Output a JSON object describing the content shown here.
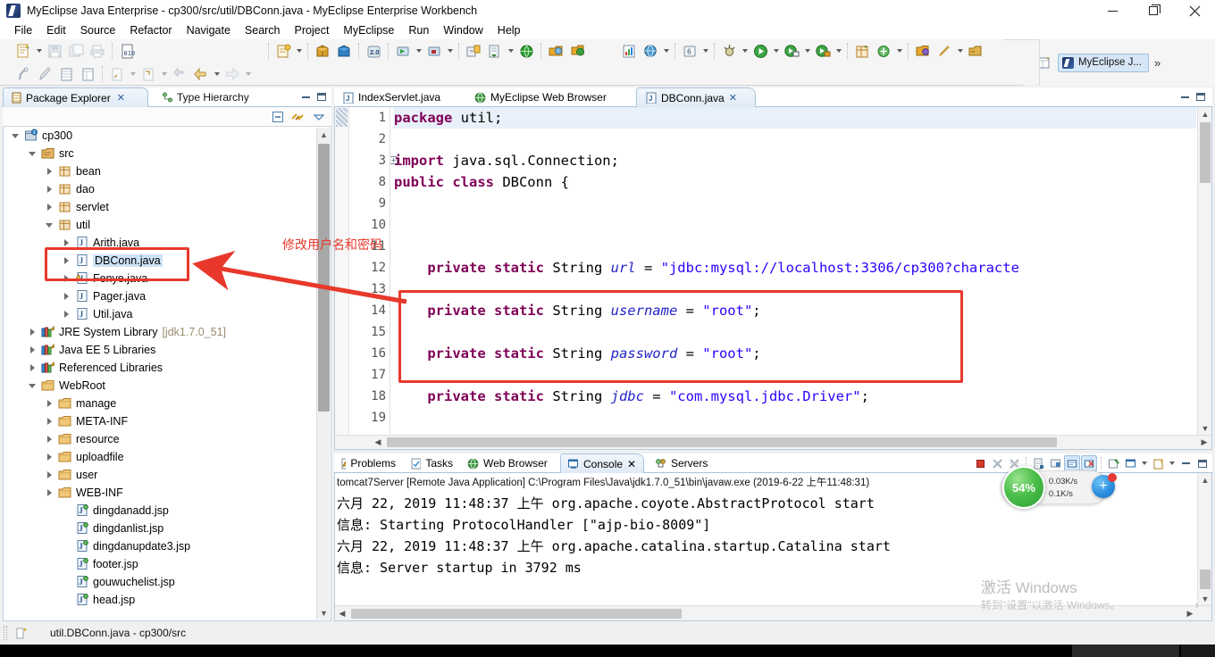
{
  "window": {
    "title": "MyEclipse Java Enterprise - cp300/src/util/DBConn.java - MyEclipse Enterprise Workbench",
    "app_icon": "myeclipse-icon",
    "controls": {
      "minimize": "minimize-icon",
      "maximize": "maximize-icon",
      "close": "close-icon"
    }
  },
  "menubar": {
    "items": [
      "File",
      "Edit",
      "Source",
      "Refactor",
      "Navigate",
      "Search",
      "Project",
      "MyEclipse",
      "Run",
      "Window",
      "Help"
    ]
  },
  "toolbar": {
    "row1_icons": [
      "new-wizard-icon",
      "save-icon",
      "save-all-icon",
      "print-icon",
      "toggle-binary-icon",
      "new-jsp-icon",
      "open-web-project-icon",
      "deploy-icon",
      "myeclipse-20-icon",
      "run-server-icon",
      "stop-server-icon",
      "sync-icon",
      "export-icon",
      "web-browser-icon",
      "open-resource-icon",
      "refresh-icon",
      "new-chart-icon",
      "globe-db-icon",
      "history-icon",
      "debug-icon",
      "run-icon",
      "run-config-icon",
      "run-secure-icon",
      "new-package-icon",
      "new-class-icon",
      "open-folder-icon",
      "quick-fix-icon",
      "open-type-icon"
    ],
    "row2_icons": [
      "annotation-icon",
      "pen-icon",
      "table-icon",
      "column-icon",
      "previous-edit-icon",
      "next-edit-icon",
      "back-nav-icon",
      "back-icon",
      "forward-icon"
    ],
    "perspective": {
      "open_perspective": "open-perspective-icon",
      "active_label": "MyEclipse J...",
      "more": "»"
    }
  },
  "sidebar": {
    "tabs": [
      {
        "label": "Package Explorer",
        "icon": "package-explorer-icon",
        "active": true,
        "closable": true
      },
      {
        "label": "Type Hierarchy",
        "icon": "type-hierarchy-icon",
        "active": false,
        "closable": false
      }
    ],
    "view_toolbar": [
      "collapse-all-icon",
      "link-with-editor-icon",
      "view-menu-icon"
    ],
    "tree": [
      {
        "label": "cp300",
        "indent": 0,
        "icon": "java-project-icon",
        "twisty": "open",
        "selected": false
      },
      {
        "label": "src",
        "indent": 1,
        "icon": "source-folder-icon",
        "twisty": "open",
        "selected": false
      },
      {
        "label": "bean",
        "indent": 2,
        "icon": "package-icon",
        "twisty": "closed",
        "selected": false
      },
      {
        "label": "dao",
        "indent": 2,
        "icon": "package-icon",
        "twisty": "closed",
        "selected": false
      },
      {
        "label": "servlet",
        "indent": 2,
        "icon": "package-icon",
        "twisty": "closed",
        "selected": false
      },
      {
        "label": "util",
        "indent": 2,
        "icon": "package-icon",
        "twisty": "open",
        "selected": false
      },
      {
        "label": "Arith.java",
        "indent": 3,
        "icon": "java-file-icon",
        "twisty": "closed",
        "selected": false
      },
      {
        "label": "DBConn.java",
        "indent": 3,
        "icon": "java-file-icon",
        "twisty": "closed",
        "selected": true
      },
      {
        "label": "Fenye.java",
        "indent": 3,
        "icon": "java-file-warning-icon",
        "twisty": "closed",
        "selected": false
      },
      {
        "label": "Pager.java",
        "indent": 3,
        "icon": "java-file-icon",
        "twisty": "closed",
        "selected": false
      },
      {
        "label": "Util.java",
        "indent": 3,
        "icon": "java-file-icon",
        "twisty": "closed",
        "selected": false
      },
      {
        "label": "JRE System Library",
        "suffix": "[jdk1.7.0_51]",
        "indent": 1,
        "icon": "library-icon",
        "twisty": "closed",
        "selected": false
      },
      {
        "label": "Java EE 5 Libraries",
        "indent": 1,
        "icon": "library-icon",
        "twisty": "closed",
        "selected": false
      },
      {
        "label": "Referenced Libraries",
        "indent": 1,
        "icon": "library-icon",
        "twisty": "closed",
        "selected": false
      },
      {
        "label": "WebRoot",
        "indent": 1,
        "icon": "folder-icon",
        "twisty": "open",
        "selected": false
      },
      {
        "label": "manage",
        "indent": 2,
        "icon": "folder-icon",
        "twisty": "closed",
        "selected": false
      },
      {
        "label": "META-INF",
        "indent": 2,
        "icon": "folder-icon",
        "twisty": "closed",
        "selected": false
      },
      {
        "label": "resource",
        "indent": 2,
        "icon": "folder-icon",
        "twisty": "closed",
        "selected": false
      },
      {
        "label": "uploadfile",
        "indent": 2,
        "icon": "folder-icon",
        "twisty": "closed",
        "selected": false
      },
      {
        "label": "user",
        "indent": 2,
        "icon": "folder-icon",
        "twisty": "closed",
        "selected": false
      },
      {
        "label": "WEB-INF",
        "indent": 2,
        "icon": "folder-icon",
        "twisty": "closed",
        "selected": false
      },
      {
        "label": "dingdanadd.jsp",
        "indent": 3,
        "icon": "jsp-file-icon",
        "twisty": "none",
        "selected": false
      },
      {
        "label": "dingdanlist.jsp",
        "indent": 3,
        "icon": "jsp-file-icon",
        "twisty": "none",
        "selected": false
      },
      {
        "label": "dingdanupdate3.jsp",
        "indent": 3,
        "icon": "jsp-file-icon",
        "twisty": "none",
        "selected": false
      },
      {
        "label": "footer.jsp",
        "indent": 3,
        "icon": "jsp-file-icon",
        "twisty": "none",
        "selected": false
      },
      {
        "label": "gouwuchelist.jsp",
        "indent": 3,
        "icon": "jsp-file-icon",
        "twisty": "none",
        "selected": false
      },
      {
        "label": "head.jsp",
        "indent": 3,
        "icon": "jsp-file-icon",
        "twisty": "none",
        "selected": false
      }
    ]
  },
  "editor": {
    "tabs": [
      {
        "label": "IndexServlet.java",
        "icon": "java-file-icon",
        "active": false,
        "closable": false
      },
      {
        "label": "MyEclipse Web Browser",
        "icon": "web-browser-icon",
        "active": false,
        "closable": false
      },
      {
        "label": "DBConn.java",
        "icon": "java-file-icon",
        "active": true,
        "closable": true
      }
    ],
    "lines": [
      {
        "num": "1",
        "fold": false,
        "current": true,
        "tokens": [
          {
            "t": "package",
            "c": "kw"
          },
          {
            "t": " util;",
            "c": "pln"
          }
        ]
      },
      {
        "num": "2",
        "fold": false,
        "current": false,
        "tokens": []
      },
      {
        "num": "3",
        "fold": true,
        "current": false,
        "tokens": [
          {
            "t": "import",
            "c": "kw"
          },
          {
            "t": " java.sql.Connection;",
            "c": "pln"
          }
        ]
      },
      {
        "num": "8",
        "fold": false,
        "current": false,
        "tokens": [
          {
            "t": "public class",
            "c": "kw"
          },
          {
            "t": " DBConn {",
            "c": "pln"
          }
        ]
      },
      {
        "num": "9",
        "fold": false,
        "current": false,
        "tokens": []
      },
      {
        "num": "10",
        "fold": false,
        "current": false,
        "tokens": []
      },
      {
        "num": "11",
        "fold": false,
        "current": false,
        "tokens": []
      },
      {
        "num": "12",
        "fold": false,
        "current": false,
        "tokens": [
          {
            "t": "    ",
            "c": "pln"
          },
          {
            "t": "private static",
            "c": "kw"
          },
          {
            "t": " String ",
            "c": "pln"
          },
          {
            "t": "url",
            "c": "fld"
          },
          {
            "t": " = ",
            "c": "pln"
          },
          {
            "t": "\"jdbc:mysql://localhost:3306/cp300?characte",
            "c": "str"
          }
        ]
      },
      {
        "num": "13",
        "fold": false,
        "current": false,
        "tokens": []
      },
      {
        "num": "14",
        "fold": false,
        "current": false,
        "tokens": [
          {
            "t": "    ",
            "c": "pln"
          },
          {
            "t": "private static",
            "c": "kw"
          },
          {
            "t": " String ",
            "c": "pln"
          },
          {
            "t": "username",
            "c": "fld"
          },
          {
            "t": " = ",
            "c": "pln"
          },
          {
            "t": "\"root\"",
            "c": "str"
          },
          {
            "t": ";",
            "c": "pln"
          }
        ]
      },
      {
        "num": "15",
        "fold": false,
        "current": false,
        "tokens": []
      },
      {
        "num": "16",
        "fold": false,
        "current": false,
        "tokens": [
          {
            "t": "    ",
            "c": "pln"
          },
          {
            "t": "private static",
            "c": "kw"
          },
          {
            "t": " String ",
            "c": "pln"
          },
          {
            "t": "password",
            "c": "fld"
          },
          {
            "t": " = ",
            "c": "pln"
          },
          {
            "t": "\"root\"",
            "c": "str"
          },
          {
            "t": ";",
            "c": "pln"
          }
        ]
      },
      {
        "num": "17",
        "fold": false,
        "current": false,
        "tokens": []
      },
      {
        "num": "18",
        "fold": false,
        "current": false,
        "tokens": [
          {
            "t": "    ",
            "c": "pln"
          },
          {
            "t": "private static",
            "c": "kw"
          },
          {
            "t": " String ",
            "c": "pln"
          },
          {
            "t": "jdbc",
            "c": "fld"
          },
          {
            "t": " = ",
            "c": "pln"
          },
          {
            "t": "\"com.mysql.jdbc.Driver\"",
            "c": "str"
          },
          {
            "t": ";",
            "c": "pln"
          }
        ]
      },
      {
        "num": "19",
        "fold": false,
        "current": false,
        "tokens": []
      }
    ]
  },
  "console": {
    "tabs": [
      {
        "label": "Problems",
        "icon": "problems-icon",
        "active": false,
        "closable": false
      },
      {
        "label": "Tasks",
        "icon": "tasks-icon",
        "active": false,
        "closable": false
      },
      {
        "label": "Web Browser",
        "icon": "web-browser-icon",
        "active": false,
        "closable": false
      },
      {
        "label": "Console",
        "icon": "console-icon",
        "active": true,
        "closable": true
      },
      {
        "label": "Servers",
        "icon": "servers-icon",
        "active": false,
        "closable": false
      }
    ],
    "toolbar_icons": [
      "terminate-icon",
      "remove-launch-icon",
      "remove-all-launches-icon",
      "show-console-icon",
      "pin-console-icon",
      "scroll-lock-icon",
      "clear-console-icon",
      "display-selected-console-icon",
      "open-console-icon",
      "minimize-icon",
      "maximize-icon"
    ],
    "header": "tomcat7Server [Remote Java Application] C:\\Program Files\\Java\\jdk1.7.0_51\\bin\\javaw.exe (2019-6-22 上午11:48:31)",
    "lines": [
      "六月 22, 2019 11:48:37 上午 org.apache.coyote.AbstractProtocol start",
      "信息: Starting ProtocolHandler [\"ajp-bio-8009\"]",
      "六月 22, 2019 11:48:37 上午 org.apache.catalina.startup.Catalina start",
      "信息: Server startup in 3792 ms"
    ]
  },
  "statusbar": {
    "icon": "editor-status-icon",
    "text": "util.DBConn.java - cp300/src"
  },
  "annotations": {
    "note_text": "修改用户名和密码",
    "color": "#e8382c",
    "boxes": [
      "sidebar-dbconn-highlight",
      "code-credentials-highlight"
    ],
    "arrow": "red-arrow-pointing-to-dbconn"
  },
  "float_widget": {
    "cpu_percent": "54%",
    "upload_speed": "0.03K/s",
    "download_speed": "0.1K/s",
    "plus_button": "add-icon"
  },
  "watermark": {
    "line1": "激活 Windows",
    "line2": "转到\"设置\"以激活 Windows。",
    "arrow": "›"
  }
}
